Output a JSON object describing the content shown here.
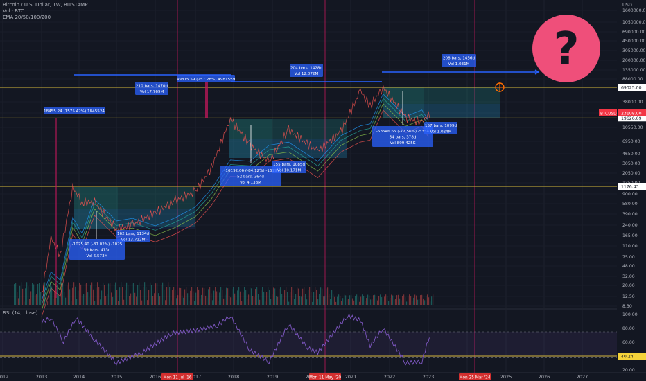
{
  "header": {
    "symbol_line": "Bitcoin / U.S. Dollar, 1W, BITSTAMP",
    "volume_line": "Vol · BTC",
    "ema_line": "EMA 20/50/100/200"
  },
  "rsi_label": "RSI (14, close)",
  "chart_data": {
    "type": "line",
    "price_axis_title": "USD",
    "price_ticks": [
      "1600000.00",
      "1050000.00",
      "690000.00",
      "450000.00",
      "305000.00",
      "200000.00",
      "135000.00",
      "88000.00",
      "58000.00",
      "38000.00",
      "25000.00",
      "10550.00",
      "6950.00",
      "4650.00",
      "3050.00",
      "2050.00",
      "1350.00",
      "900.00",
      "580.00",
      "390.00",
      "240.00",
      "165.00",
      "110.00",
      "75.00",
      "48.00",
      "32.00",
      "20.00",
      "12.50",
      "8.30"
    ],
    "rsi_ticks": [
      "100.00",
      "80.00",
      "60.00",
      "40.00",
      "20.00"
    ],
    "x_ticks": [
      "2012",
      "2013",
      "2014",
      "2015",
      "2016",
      "2017",
      "2018",
      "2019",
      "2020",
      "2021",
      "2022",
      "2023",
      "2024",
      "2025",
      "2026",
      "2027"
    ],
    "marker_dates": [
      "Mon 11 Jul '16",
      "Mon 11 May '20",
      "Mon 25 Mar '24"
    ],
    "price_labels": {
      "level_top": "69325.00",
      "level_current": "23108.00",
      "level_mid": "19626.69",
      "level_low": "1176.43",
      "current_ticker": "BTCUSD",
      "rsi_value": "40.24"
    },
    "horizontal_levels": [
      69325,
      19626.69,
      1176.43
    ],
    "boxes": [
      {
        "pair": "1",
        "lines": [
          "-1025.40 (-87.02%) -1025",
          "59 bars, 413d",
          "Vol 6.573M"
        ]
      },
      {
        "pair": "1",
        "lines": [
          "162 bars, 1134d",
          "Vol 13.712M"
        ]
      },
      {
        "pair": "2",
        "lines": [
          "-16192.06 (-84.12%) -1619",
          "52 bars, 364d",
          "Vol 4.138M"
        ]
      },
      {
        "pair": "2",
        "lines": [
          "155 bars, 1085d",
          "Vol 10.171M"
        ]
      },
      {
        "pair": "3",
        "lines": [
          "-53546.65 (-77.56%) -5354",
          "54 bars, 378d",
          "Vol 899.425K"
        ]
      },
      {
        "pair": "3",
        "lines": [
          "157 bars, 1099d",
          "Vol 1.024M"
        ]
      },
      {
        "pair": "top",
        "lines": [
          "18455.24 (1575.42%) 1845524"
        ]
      },
      {
        "pair": "top",
        "lines": [
          "210 bars, 1470d",
          "Vol 17.769M"
        ]
      },
      {
        "pair": "top",
        "lines": [
          "49815.59 (257.28%) 4981559"
        ]
      },
      {
        "pair": "top",
        "lines": [
          "204 bars, 1428d",
          "Vol 12.072M"
        ]
      },
      {
        "pair": "top",
        "lines": [
          "208 bars, 1456d",
          "Vol 1.031M"
        ]
      }
    ],
    "price_series_approx": {
      "dates": [
        "2013-01",
        "2013-04",
        "2013-07",
        "2013-11",
        "2014-02",
        "2014-06",
        "2015-01",
        "2015-06",
        "2016-01",
        "2016-07",
        "2017-01",
        "2017-06",
        "2017-12",
        "2018-06",
        "2018-12",
        "2019-06",
        "2020-03",
        "2020-10",
        "2021-04",
        "2021-07",
        "2021-11",
        "2022-06",
        "2022-11",
        "2023-01"
      ],
      "values": [
        13,
        140,
        70,
        1150,
        600,
        620,
        200,
        240,
        400,
        650,
        950,
        2500,
        19000,
        6500,
        3200,
        12000,
        5000,
        11000,
        60000,
        32000,
        69000,
        20000,
        16000,
        23100
      ]
    },
    "rsi_series_approx": {
      "dates": [
        "2013-01",
        "2013-04",
        "2013-08",
        "2013-12",
        "2014-06",
        "2015-01",
        "2015-09",
        "2016-06",
        "2017-01",
        "2017-08",
        "2017-12",
        "2018-06",
        "2018-12",
        "2019-06",
        "2019-12",
        "2020-03",
        "2020-12",
        "2021-04",
        "2021-07",
        "2021-11",
        "2022-06",
        "2022-11",
        "2023-01"
      ],
      "values": [
        85,
        92,
        55,
        92,
        58,
        22,
        38,
        68,
        72,
        80,
        95,
        42,
        24,
        82,
        45,
        38,
        95,
        88,
        48,
        76,
        22,
        24,
        58
      ]
    },
    "rsi_band": [
      30,
      70
    ]
  }
}
